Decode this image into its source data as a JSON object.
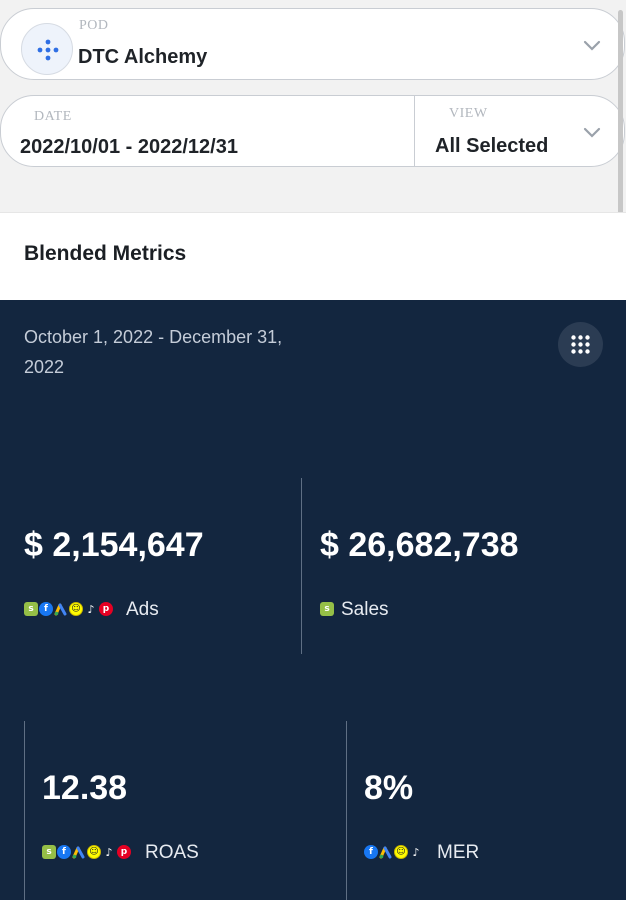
{
  "pod": {
    "label": "POD",
    "value": "DTC Alchemy"
  },
  "filters": {
    "date": {
      "label": "DATE",
      "value": "2022/10/01 - 2022/12/31"
    },
    "view": {
      "label": "VIEW",
      "value": "All Selected"
    }
  },
  "section": {
    "title": "Blended Metrics"
  },
  "panel": {
    "date_range": "October 1, 2022 - December 31, 2022",
    "metrics": [
      {
        "value": "$ 2,154,647",
        "label": "Ads",
        "icons": [
          "shopify-icon",
          "facebook-icon",
          "google-ads-icon",
          "snapchat-icon",
          "tiktok-icon",
          "pinterest-icon"
        ]
      },
      {
        "value": "$ 26,682,738",
        "label": "Sales",
        "icons": [
          "shopify-icon"
        ]
      },
      {
        "value": "12.38",
        "label": "ROAS",
        "icons": [
          "shopify-icon",
          "facebook-icon",
          "google-ads-icon",
          "snapchat-icon",
          "tiktok-icon",
          "pinterest-icon"
        ]
      },
      {
        "value": "8%",
        "label": "MER",
        "icons": [
          "facebook-icon",
          "google-ads-icon",
          "snapchat-icon",
          "tiktok-icon"
        ]
      }
    ]
  },
  "colors": {
    "panel_bg": "#13263f",
    "page_bg": "#f2f2f2",
    "accent_blue": "#1a73e8"
  }
}
